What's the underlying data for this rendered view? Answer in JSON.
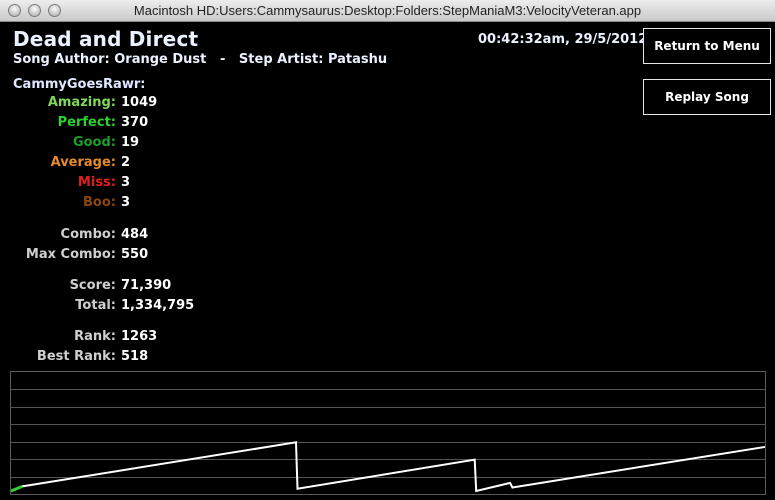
{
  "window": {
    "title": "Macintosh HD:Users:Cammysaurus:Desktop:Folders:StepManiaM3:VelocityVeteran.app"
  },
  "song": {
    "title": "Dead and Direct",
    "credits": "Song Author: Orange Dust   -   Step Artist: Patashu"
  },
  "datetime": "00:42:32am, 29/5/2012",
  "buttons": {
    "return_to_menu": "Return to Menu",
    "replay_song": "Replay Song"
  },
  "player": "CammyGoesRawr:",
  "judgments": [
    {
      "label": "Amazing:",
      "value": "1049",
      "color": "#7ed957"
    },
    {
      "label": "Perfect:",
      "value": "370",
      "color": "#2fd02f"
    },
    {
      "label": "Good:",
      "value": "19",
      "color": "#1e9e2a"
    },
    {
      "label": "Average:",
      "value": "2",
      "color": "#e48a2a"
    },
    {
      "label": "Miss:",
      "value": "3",
      "color": "#e02020"
    },
    {
      "label": "Boo:",
      "value": "3",
      "color": "#8b4513"
    }
  ],
  "stats": [
    {
      "label": "Combo:",
      "value": "484"
    },
    {
      "label": "Max Combo:",
      "value": "550"
    },
    {
      "label": "Score:",
      "value": "71,390"
    },
    {
      "label": "Total:",
      "value": "1,334,795"
    },
    {
      "label": "Rank:",
      "value": "1263"
    },
    {
      "label": "Best Rank:",
      "value": "518"
    }
  ],
  "label_color": "#cfcfcf",
  "combo_graph": {
    "description_free": true,
    "x": [
      0,
      0.015,
      0.378,
      0.38,
      0.615,
      0.617,
      0.662,
      0.665,
      1.0
    ],
    "y": [
      0,
      0.04,
      0.42,
      0.02,
      0.27,
      0.0,
      0.07,
      0.03,
      0.38
    ],
    "highlight_color": "#2fd02f",
    "line_color": "#ffffff",
    "grid_lines": 6
  }
}
